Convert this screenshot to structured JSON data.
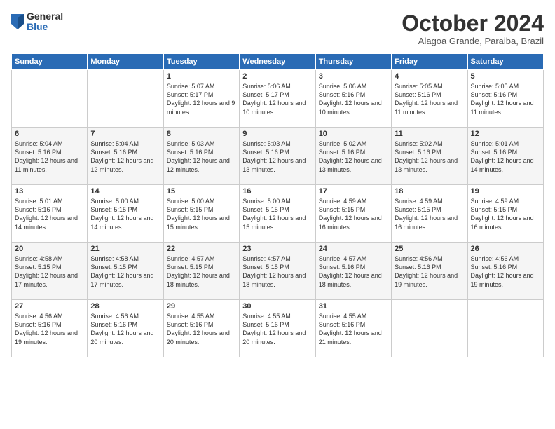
{
  "logo": {
    "general": "General",
    "blue": "Blue"
  },
  "title": "October 2024",
  "subtitle": "Alagoa Grande, Paraiba, Brazil",
  "headers": [
    "Sunday",
    "Monday",
    "Tuesday",
    "Wednesday",
    "Thursday",
    "Friday",
    "Saturday"
  ],
  "weeks": [
    [
      {
        "day": "",
        "info": ""
      },
      {
        "day": "",
        "info": ""
      },
      {
        "day": "1",
        "info": "Sunrise: 5:07 AM\nSunset: 5:17 PM\nDaylight: 12 hours\nand 9 minutes."
      },
      {
        "day": "2",
        "info": "Sunrise: 5:06 AM\nSunset: 5:17 PM\nDaylight: 12 hours\nand 10 minutes."
      },
      {
        "day": "3",
        "info": "Sunrise: 5:06 AM\nSunset: 5:16 PM\nDaylight: 12 hours\nand 10 minutes."
      },
      {
        "day": "4",
        "info": "Sunrise: 5:05 AM\nSunset: 5:16 PM\nDaylight: 12 hours\nand 11 minutes."
      },
      {
        "day": "5",
        "info": "Sunrise: 5:05 AM\nSunset: 5:16 PM\nDaylight: 12 hours\nand 11 minutes."
      }
    ],
    [
      {
        "day": "6",
        "info": "Sunrise: 5:04 AM\nSunset: 5:16 PM\nDaylight: 12 hours\nand 11 minutes."
      },
      {
        "day": "7",
        "info": "Sunrise: 5:04 AM\nSunset: 5:16 PM\nDaylight: 12 hours\nand 12 minutes."
      },
      {
        "day": "8",
        "info": "Sunrise: 5:03 AM\nSunset: 5:16 PM\nDaylight: 12 hours\nand 12 minutes."
      },
      {
        "day": "9",
        "info": "Sunrise: 5:03 AM\nSunset: 5:16 PM\nDaylight: 12 hours\nand 13 minutes."
      },
      {
        "day": "10",
        "info": "Sunrise: 5:02 AM\nSunset: 5:16 PM\nDaylight: 12 hours\nand 13 minutes."
      },
      {
        "day": "11",
        "info": "Sunrise: 5:02 AM\nSunset: 5:16 PM\nDaylight: 12 hours\nand 13 minutes."
      },
      {
        "day": "12",
        "info": "Sunrise: 5:01 AM\nSunset: 5:16 PM\nDaylight: 12 hours\nand 14 minutes."
      }
    ],
    [
      {
        "day": "13",
        "info": "Sunrise: 5:01 AM\nSunset: 5:16 PM\nDaylight: 12 hours\nand 14 minutes."
      },
      {
        "day": "14",
        "info": "Sunrise: 5:00 AM\nSunset: 5:15 PM\nDaylight: 12 hours\nand 14 minutes."
      },
      {
        "day": "15",
        "info": "Sunrise: 5:00 AM\nSunset: 5:15 PM\nDaylight: 12 hours\nand 15 minutes."
      },
      {
        "day": "16",
        "info": "Sunrise: 5:00 AM\nSunset: 5:15 PM\nDaylight: 12 hours\nand 15 minutes."
      },
      {
        "day": "17",
        "info": "Sunrise: 4:59 AM\nSunset: 5:15 PM\nDaylight: 12 hours\nand 16 minutes."
      },
      {
        "day": "18",
        "info": "Sunrise: 4:59 AM\nSunset: 5:15 PM\nDaylight: 12 hours\nand 16 minutes."
      },
      {
        "day": "19",
        "info": "Sunrise: 4:59 AM\nSunset: 5:15 PM\nDaylight: 12 hours\nand 16 minutes."
      }
    ],
    [
      {
        "day": "20",
        "info": "Sunrise: 4:58 AM\nSunset: 5:15 PM\nDaylight: 12 hours\nand 17 minutes."
      },
      {
        "day": "21",
        "info": "Sunrise: 4:58 AM\nSunset: 5:15 PM\nDaylight: 12 hours\nand 17 minutes."
      },
      {
        "day": "22",
        "info": "Sunrise: 4:57 AM\nSunset: 5:15 PM\nDaylight: 12 hours\nand 18 minutes."
      },
      {
        "day": "23",
        "info": "Sunrise: 4:57 AM\nSunset: 5:15 PM\nDaylight: 12 hours\nand 18 minutes."
      },
      {
        "day": "24",
        "info": "Sunrise: 4:57 AM\nSunset: 5:16 PM\nDaylight: 12 hours\nand 18 minutes."
      },
      {
        "day": "25",
        "info": "Sunrise: 4:56 AM\nSunset: 5:16 PM\nDaylight: 12 hours\nand 19 minutes."
      },
      {
        "day": "26",
        "info": "Sunrise: 4:56 AM\nSunset: 5:16 PM\nDaylight: 12 hours\nand 19 minutes."
      }
    ],
    [
      {
        "day": "27",
        "info": "Sunrise: 4:56 AM\nSunset: 5:16 PM\nDaylight: 12 hours\nand 19 minutes."
      },
      {
        "day": "28",
        "info": "Sunrise: 4:56 AM\nSunset: 5:16 PM\nDaylight: 12 hours\nand 20 minutes."
      },
      {
        "day": "29",
        "info": "Sunrise: 4:55 AM\nSunset: 5:16 PM\nDaylight: 12 hours\nand 20 minutes."
      },
      {
        "day": "30",
        "info": "Sunrise: 4:55 AM\nSunset: 5:16 PM\nDaylight: 12 hours\nand 20 minutes."
      },
      {
        "day": "31",
        "info": "Sunrise: 4:55 AM\nSunset: 5:16 PM\nDaylight: 12 hours\nand 21 minutes."
      },
      {
        "day": "",
        "info": ""
      },
      {
        "day": "",
        "info": ""
      }
    ]
  ]
}
